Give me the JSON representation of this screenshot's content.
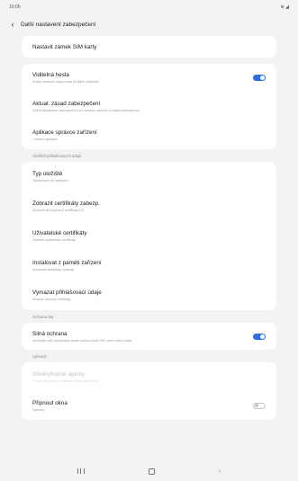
{
  "statusbar": {
    "time": "10:06",
    "icons": "⊕ ◢"
  },
  "appbar": {
    "title": "Další nastavení zabezpečení",
    "back_icon": "back-arrow-icon"
  },
  "top_card": {
    "item": "Nastavit zámek SIM karty"
  },
  "card1": [
    {
      "title": "Viditelná hesla",
      "sub": "Krátce zobrazit znaky hesla při jejich zadávání",
      "toggle": true
    },
    {
      "title": "Aktual. zásad zabezpečení",
      "sub": "Ověřit aktualizace zabezpečení pro ochranu zařízení a zásad zabezpečení"
    },
    {
      "title": "Aplikace správce zařízení",
      "sub": "1 aktivní aplikace"
    }
  ],
  "section2": "Úložiště přihlašovacích údajů",
  "card2": [
    {
      "title": "Typ úložiště",
      "sub": "Zálohováno do hardwaru"
    },
    {
      "title": "Zobrazit certifikáty zabezp.",
      "sub": "Zobrazit důvěryhodné certifikáty CA"
    },
    {
      "title": "Uživatelské certifikáty",
      "sub": "Zobrazit uživatelské certifikáty"
    },
    {
      "title": "Instalovat z paměti zařízení",
      "sub": "Instalovat certifikáty z paměti"
    },
    {
      "title": "Vymazat přihlašovací údaje",
      "sub": "Smazat všechny certifikáty"
    }
  ],
  "section3": "Ochrana dat",
  "card3": [
    {
      "title": "Silná ochrana",
      "sub": "Zašifrujte svůj zálohovaný obsah pomocí kódu PIN, vzoru nebo hesla",
      "toggle": true
    }
  ],
  "section4": "Upřesnit",
  "card4": [
    {
      "title": "Důvěryhodné agenty",
      "sub": "Pro použití nejprve nastavte zámek obrazovky",
      "disabled": true
    },
    {
      "title": "Připnout okna",
      "sub": "Vypnuto",
      "toggle": false
    }
  ],
  "navbar": {
    "recent": "recent-apps-icon",
    "home": "home-icon",
    "back": "‹"
  }
}
